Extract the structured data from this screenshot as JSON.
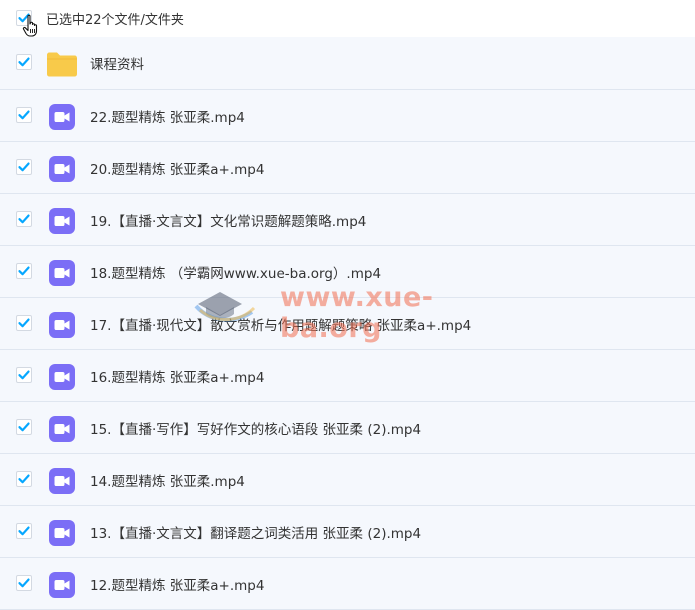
{
  "header": {
    "selection_label": "已选中22个文件/文件夹"
  },
  "files": [
    {
      "name": "课程资料",
      "icon": "folder-icon"
    },
    {
      "name": "22.题型精炼 张亚柔.mp4",
      "icon": "video-file-icon"
    },
    {
      "name": "20.题型精炼 张亚柔a+.mp4",
      "icon": "video-file-icon"
    },
    {
      "name": "19.【直播·文言文】文化常识题解题策略.mp4",
      "icon": "video-file-icon"
    },
    {
      "name": "18.题型精炼 （学霸网www.xue-ba.org）.mp4",
      "icon": "video-file-icon"
    },
    {
      "name": "17.【直播·现代文】散文赏析与作用题解题策略 张亚柔a+.mp4",
      "icon": "video-file-icon"
    },
    {
      "name": "16.题型精炼 张亚柔a+.mp4",
      "icon": "video-file-icon"
    },
    {
      "name": "15.【直播·写作】写好作文的核心语段 张亚柔 (2).mp4",
      "icon": "video-file-icon"
    },
    {
      "name": "14.题型精炼 张亚柔.mp4",
      "icon": "video-file-icon"
    },
    {
      "name": "13.【直播·文言文】翻译题之词类活用 张亚柔 (2).mp4",
      "icon": "video-file-icon"
    },
    {
      "name": "12.题型精炼 张亚柔a+.mp4",
      "icon": "video-file-icon"
    }
  ],
  "watermark": {
    "text": "www.xue-ba.org"
  },
  "colors": {
    "checkbox_check": "#06a7ff",
    "folder": "#f8ca4a",
    "video_icon": "#7b6ef6",
    "row_bg": "#f5f8fd",
    "row_border": "#dfe6f0",
    "watermark": "#f06e50"
  }
}
